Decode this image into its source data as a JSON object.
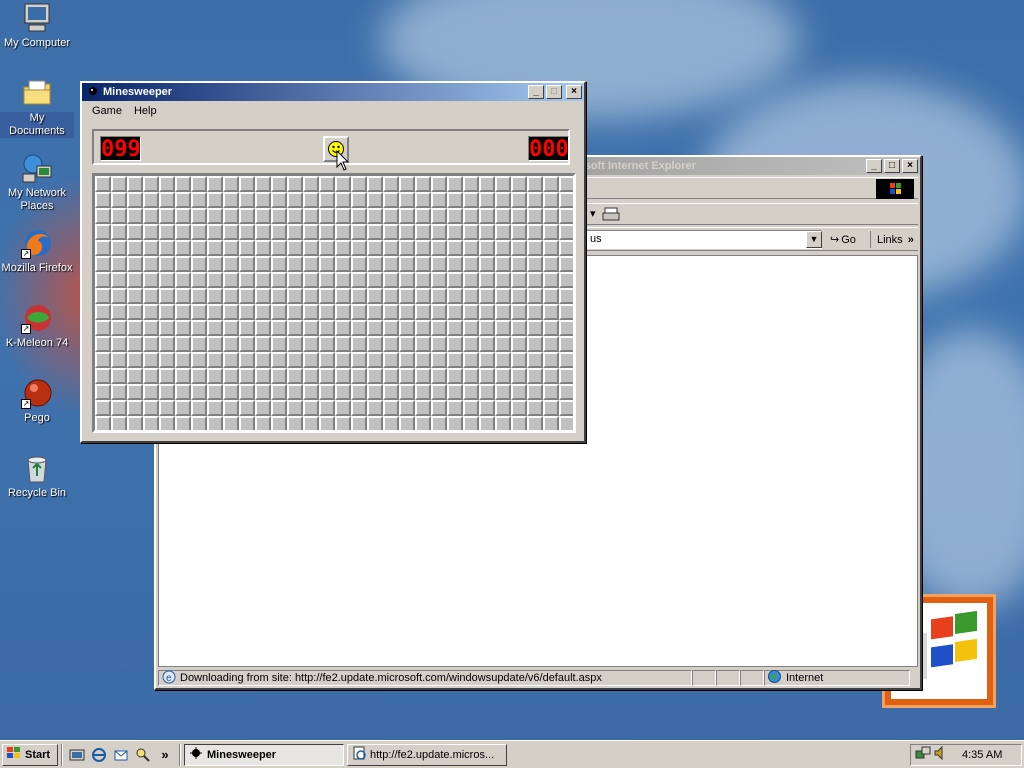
{
  "desktop": {
    "icons": [
      {
        "label": "My Computer",
        "icon": "computer-icon"
      },
      {
        "label": "My Documents",
        "icon": "folder-icon"
      },
      {
        "label": "My Network Places",
        "icon": "network-icon"
      },
      {
        "label": "Mozilla Firefox",
        "icon": "firefox-icon"
      },
      {
        "label": "K-Meleon 74",
        "icon": "kmeleon-icon"
      },
      {
        "label": "Pego",
        "icon": "pego-icon"
      },
      {
        "label": "Recycle Bin",
        "icon": "recycle-bin-icon"
      }
    ]
  },
  "minesweeper": {
    "title": "Minesweeper",
    "menu": [
      "Game",
      "Help"
    ],
    "mine_counter": "099",
    "timer": "000",
    "grid": {
      "cols": 30,
      "rows": 16
    }
  },
  "ie": {
    "title": "osoft Internet Explorer",
    "address_fragment": "us",
    "go_label": "Go",
    "links_label": "Links",
    "status_text": "Downloading from site: http://fe2.update.microsoft.com/windowsupdate/v6/default.aspx",
    "zone": "Internet"
  },
  "taskbar": {
    "start_label": "Start",
    "tasks": [
      {
        "label": "Minesweeper",
        "active": true
      },
      {
        "label": "http://fe2.update.micros...",
        "active": false
      }
    ],
    "clock": "4:35 AM"
  }
}
